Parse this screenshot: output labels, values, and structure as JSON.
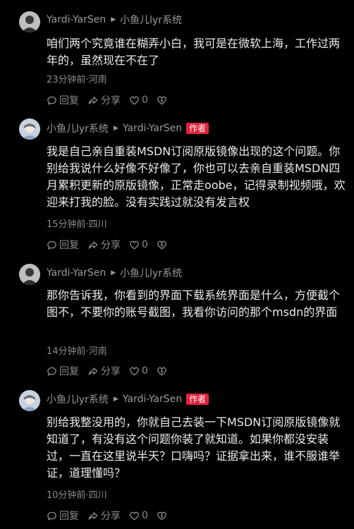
{
  "comments": [
    {
      "author": "Yardi-YarSen",
      "reply_to": "小鱼儿lyr系统",
      "is_author": false,
      "text": "咱们两个究竟谁在糊弄小白，我可是在微软上海，工作过两年的，虽然现在不在了",
      "meta": "23分钟前·河南",
      "reply_label": "回复",
      "share_label": "分享",
      "like_count": "0"
    },
    {
      "author": "小鱼儿lyr系统",
      "reply_to": "Yardi-YarSen",
      "is_author": true,
      "badge": "作者",
      "text": "我是自己亲自重装MSDN订阅原版镜像出现的这个问题。你别给我说什么好像不好像了，你也可以去亲自重装MSDN四月累积更新的原版镜像，正常走oobe，记得录制视频哦，欢迎来打我的脸。没有实践过就没有发言权",
      "meta": "15分钟前·四川",
      "reply_label": "回复",
      "share_label": "分享",
      "like_count": "0"
    },
    {
      "author": "Yardi-YarSen",
      "reply_to": "小鱼儿lyr系统",
      "is_author": false,
      "text": "那你告诉我，你看到的界面下载系统界面是什么，方便截个图不，不要你的账号截图，我看你访问的那个msdn的界面",
      "meta": "14分钟前·河南",
      "reply_label": "回复",
      "share_label": "分享",
      "like_count": "0"
    },
    {
      "author": "小鱼儿lyr系统",
      "reply_to": "Yardi-YarSen",
      "is_author": true,
      "badge": "作者",
      "text": "别给我整没用的，你就自己去装一下MSDN订阅原版镜像就知道了，有没有这个问题你装了就知道。如果你都没安装过，一直在这里说半天？口嗨吗？证据拿出来，谁不服谁举证，道理懂吗？",
      "meta": "10分钟前·四川",
      "reply_label": "回复",
      "share_label": "分享",
      "like_count": "0"
    }
  ]
}
